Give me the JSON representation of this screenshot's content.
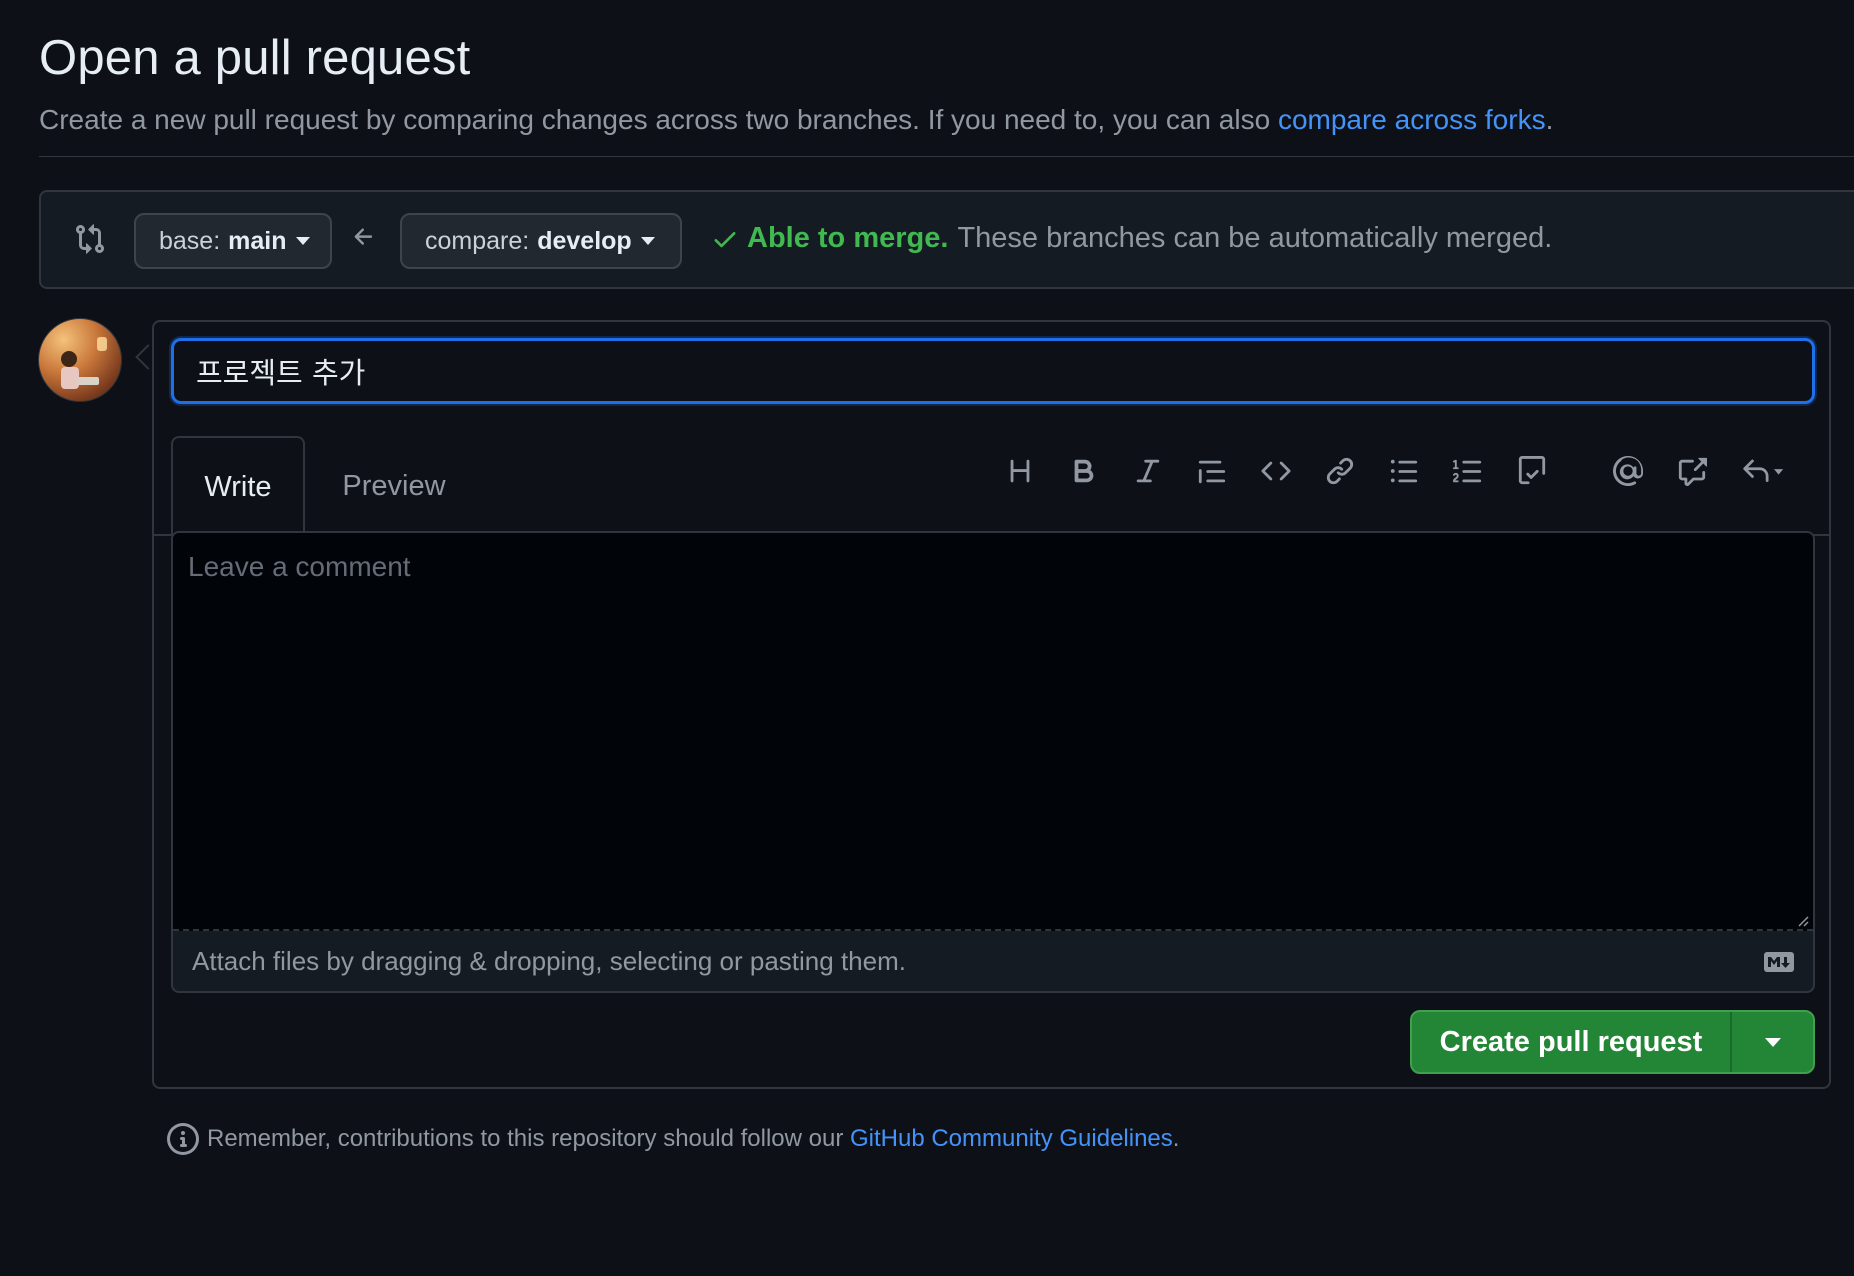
{
  "header": {
    "title": "Open a pull request",
    "subtitle_prefix": "Create a new pull request by comparing changes across two branches. If you need to, you can also ",
    "subtitle_link": "compare across forks",
    "subtitle_suffix": "."
  },
  "compare": {
    "base_prefix": "base:",
    "base_branch": "main",
    "compare_prefix": "compare:",
    "compare_branch": "develop",
    "merge_status": "Able to merge.",
    "merge_desc": "These branches can be automatically merged.",
    "status_color": "#3fb950"
  },
  "form": {
    "title_value": "프로젝트 추가",
    "tabs": [
      {
        "label": "Write",
        "active": true
      },
      {
        "label": "Preview",
        "active": false
      }
    ],
    "toolbar_icons": [
      "heading-icon",
      "bold-icon",
      "italic-icon",
      "quote-icon",
      "code-icon",
      "link-icon",
      "unordered-list-icon",
      "ordered-list-icon",
      "task-list-icon",
      "mention-icon",
      "cross-reference-icon",
      "reply-icon"
    ],
    "comment_placeholder": "Leave a comment",
    "attach_text": "Attach files by dragging & dropping, selecting or pasting them.",
    "submit_label": "Create pull request",
    "accent_color": "#238636",
    "focus_color": "#1f6feb"
  },
  "footer": {
    "note_prefix": "Remember, contributions to this repository should follow our ",
    "note_link": "GitHub Community Guidelines",
    "note_suffix": "."
  }
}
